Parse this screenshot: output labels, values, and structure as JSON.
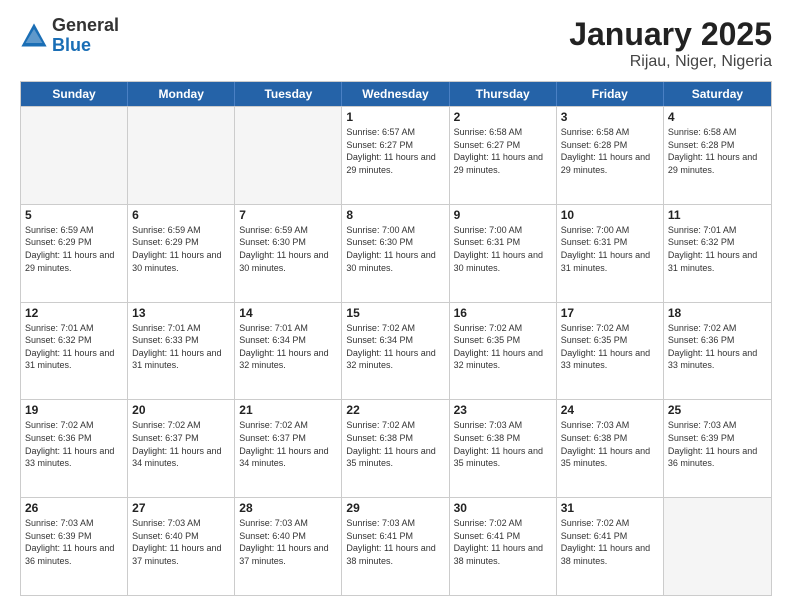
{
  "logo": {
    "general": "General",
    "blue": "Blue"
  },
  "title": {
    "month": "January 2025",
    "location": "Rijau, Niger, Nigeria"
  },
  "weekdays": [
    "Sunday",
    "Monday",
    "Tuesday",
    "Wednesday",
    "Thursday",
    "Friday",
    "Saturday"
  ],
  "rows": [
    [
      {
        "day": "",
        "empty": true
      },
      {
        "day": "",
        "empty": true
      },
      {
        "day": "",
        "empty": true
      },
      {
        "day": "1",
        "sunrise": "6:57 AM",
        "sunset": "6:27 PM",
        "daylight": "11 hours and 29 minutes."
      },
      {
        "day": "2",
        "sunrise": "6:58 AM",
        "sunset": "6:27 PM",
        "daylight": "11 hours and 29 minutes."
      },
      {
        "day": "3",
        "sunrise": "6:58 AM",
        "sunset": "6:28 PM",
        "daylight": "11 hours and 29 minutes."
      },
      {
        "day": "4",
        "sunrise": "6:58 AM",
        "sunset": "6:28 PM",
        "daylight": "11 hours and 29 minutes."
      }
    ],
    [
      {
        "day": "5",
        "sunrise": "6:59 AM",
        "sunset": "6:29 PM",
        "daylight": "11 hours and 29 minutes."
      },
      {
        "day": "6",
        "sunrise": "6:59 AM",
        "sunset": "6:29 PM",
        "daylight": "11 hours and 30 minutes."
      },
      {
        "day": "7",
        "sunrise": "6:59 AM",
        "sunset": "6:30 PM",
        "daylight": "11 hours and 30 minutes."
      },
      {
        "day": "8",
        "sunrise": "7:00 AM",
        "sunset": "6:30 PM",
        "daylight": "11 hours and 30 minutes."
      },
      {
        "day": "9",
        "sunrise": "7:00 AM",
        "sunset": "6:31 PM",
        "daylight": "11 hours and 30 minutes."
      },
      {
        "day": "10",
        "sunrise": "7:00 AM",
        "sunset": "6:31 PM",
        "daylight": "11 hours and 31 minutes."
      },
      {
        "day": "11",
        "sunrise": "7:01 AM",
        "sunset": "6:32 PM",
        "daylight": "11 hours and 31 minutes."
      }
    ],
    [
      {
        "day": "12",
        "sunrise": "7:01 AM",
        "sunset": "6:32 PM",
        "daylight": "11 hours and 31 minutes."
      },
      {
        "day": "13",
        "sunrise": "7:01 AM",
        "sunset": "6:33 PM",
        "daylight": "11 hours and 31 minutes."
      },
      {
        "day": "14",
        "sunrise": "7:01 AM",
        "sunset": "6:34 PM",
        "daylight": "11 hours and 32 minutes."
      },
      {
        "day": "15",
        "sunrise": "7:02 AM",
        "sunset": "6:34 PM",
        "daylight": "11 hours and 32 minutes."
      },
      {
        "day": "16",
        "sunrise": "7:02 AM",
        "sunset": "6:35 PM",
        "daylight": "11 hours and 32 minutes."
      },
      {
        "day": "17",
        "sunrise": "7:02 AM",
        "sunset": "6:35 PM",
        "daylight": "11 hours and 33 minutes."
      },
      {
        "day": "18",
        "sunrise": "7:02 AM",
        "sunset": "6:36 PM",
        "daylight": "11 hours and 33 minutes."
      }
    ],
    [
      {
        "day": "19",
        "sunrise": "7:02 AM",
        "sunset": "6:36 PM",
        "daylight": "11 hours and 33 minutes."
      },
      {
        "day": "20",
        "sunrise": "7:02 AM",
        "sunset": "6:37 PM",
        "daylight": "11 hours and 34 minutes."
      },
      {
        "day": "21",
        "sunrise": "7:02 AM",
        "sunset": "6:37 PM",
        "daylight": "11 hours and 34 minutes."
      },
      {
        "day": "22",
        "sunrise": "7:02 AM",
        "sunset": "6:38 PM",
        "daylight": "11 hours and 35 minutes."
      },
      {
        "day": "23",
        "sunrise": "7:03 AM",
        "sunset": "6:38 PM",
        "daylight": "11 hours and 35 minutes."
      },
      {
        "day": "24",
        "sunrise": "7:03 AM",
        "sunset": "6:38 PM",
        "daylight": "11 hours and 35 minutes."
      },
      {
        "day": "25",
        "sunrise": "7:03 AM",
        "sunset": "6:39 PM",
        "daylight": "11 hours and 36 minutes."
      }
    ],
    [
      {
        "day": "26",
        "sunrise": "7:03 AM",
        "sunset": "6:39 PM",
        "daylight": "11 hours and 36 minutes."
      },
      {
        "day": "27",
        "sunrise": "7:03 AM",
        "sunset": "6:40 PM",
        "daylight": "11 hours and 37 minutes."
      },
      {
        "day": "28",
        "sunrise": "7:03 AM",
        "sunset": "6:40 PM",
        "daylight": "11 hours and 37 minutes."
      },
      {
        "day": "29",
        "sunrise": "7:03 AM",
        "sunset": "6:41 PM",
        "daylight": "11 hours and 38 minutes."
      },
      {
        "day": "30",
        "sunrise": "7:02 AM",
        "sunset": "6:41 PM",
        "daylight": "11 hours and 38 minutes."
      },
      {
        "day": "31",
        "sunrise": "7:02 AM",
        "sunset": "6:41 PM",
        "daylight": "11 hours and 38 minutes."
      },
      {
        "day": "",
        "empty": true
      }
    ]
  ]
}
